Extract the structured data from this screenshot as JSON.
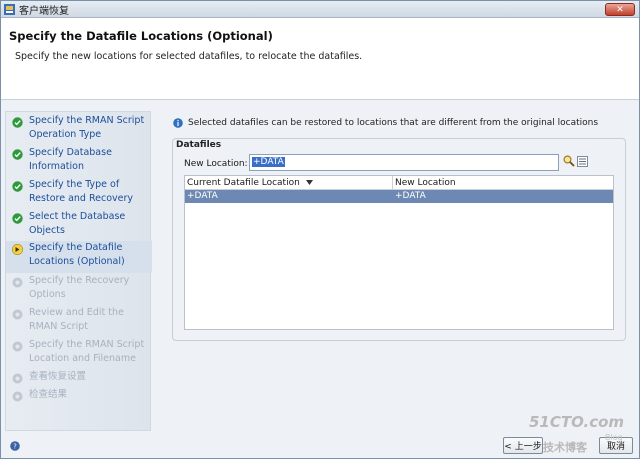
{
  "window": {
    "title": "客户端恢复",
    "close_label": "✕"
  },
  "header": {
    "title": "Specify the Datafile Locations (Optional)",
    "description": "Specify the new locations for selected datafiles, to relocate the datafiles."
  },
  "steps": [
    {
      "label": "Specify the RMAN Script Operation Type",
      "state": "done"
    },
    {
      "label": "Specify Database Information",
      "state": "done"
    },
    {
      "label": "Specify the Type of Restore and Recovery",
      "state": "done"
    },
    {
      "label": "Select the Database Objects",
      "state": "done"
    },
    {
      "label": "Specify the Datafile Locations (Optional)",
      "state": "current"
    },
    {
      "label": "Specify the Recovery Options",
      "state": "pending"
    },
    {
      "label": "Review and Edit the RMAN Script",
      "state": "pending"
    },
    {
      "label": "Specify the RMAN Script Location and Filename",
      "state": "pending"
    },
    {
      "label": "查看恢复设置",
      "state": "pending"
    },
    {
      "label": "检查结果",
      "state": "pending"
    }
  ],
  "main": {
    "info_text": "Selected datafiles can be restored to locations that are different from the original locations",
    "group_title": "Datafiles",
    "new_location_label": "New Location:",
    "new_location_value": "+DATA",
    "table": {
      "columns": [
        "Current Datafile Location",
        "New Location"
      ],
      "rows": [
        {
          "current": "+DATA",
          "new": "+DATA"
        }
      ]
    }
  },
  "footer": {
    "back_label": "< 上一步",
    "cancel_label": "取消"
  },
  "watermark": {
    "logo": "51CTO.com",
    "subtitle": "技术博客",
    "blog": "Blog"
  },
  "colors": {
    "accent": "#1b4e9b",
    "selected_row": "#6d88b2",
    "done_check": "#2e9a3a"
  }
}
